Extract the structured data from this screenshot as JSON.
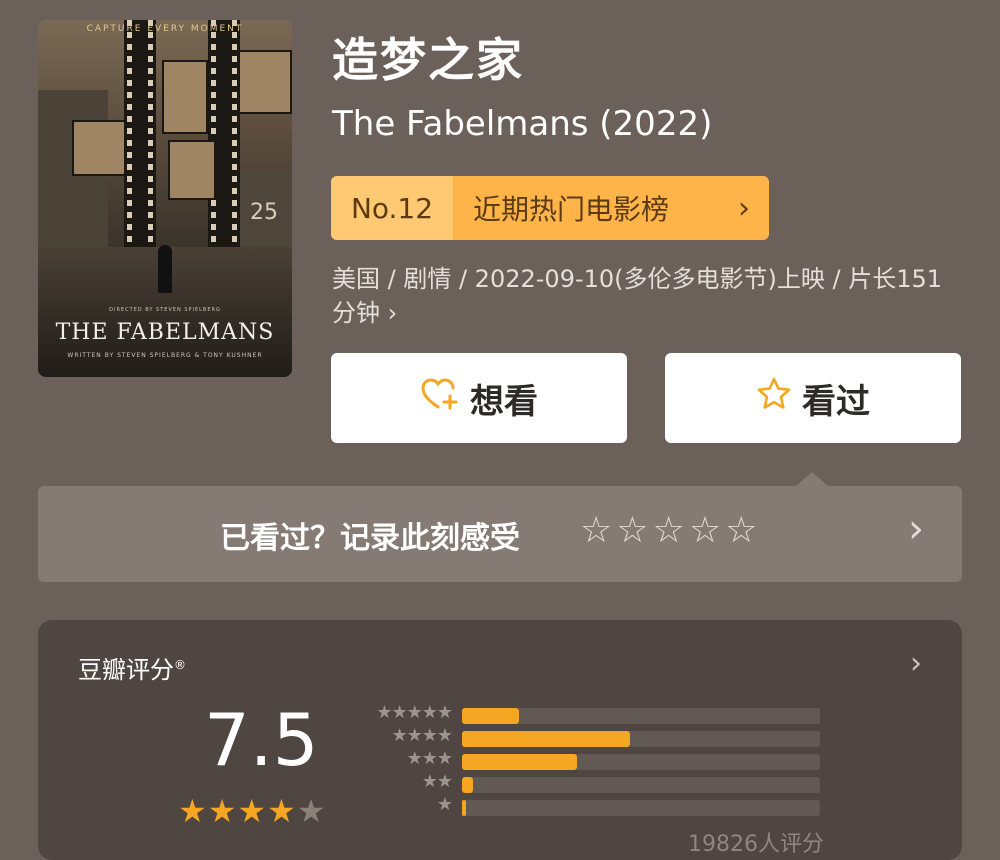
{
  "poster": {
    "tagline": "CAPTURE EVERY MOMENT",
    "title": "THE FABELMANS",
    "director_credit": "DIRECTED BY STEVEN SPIELBERG",
    "writer_credit": "WRITTEN BY STEVEN SPIELBERG & TONY KUSHNER",
    "stage_number": "25"
  },
  "title_cn": "造梦之家",
  "title_en": "The Fabelmans (2022)",
  "rank": {
    "number": "No.12",
    "label": "近期热门电影榜",
    "chevron": "›"
  },
  "meta": "美国 / 剧情 / 2022-09-10(多伦多电影节)上映 / 片长151分钟 ›",
  "buttons": {
    "want": {
      "icon": "heart-plus-icon",
      "label": "想看"
    },
    "seen": {
      "icon": "star-outline-icon",
      "label": "看过"
    }
  },
  "record": {
    "prompt": "已看过？记录此刻感受",
    "stars": "☆☆☆☆☆",
    "arrow": "›"
  },
  "rating": {
    "header": "豆瓣评分",
    "mark": "®",
    "arrow": "›",
    "score": "7.5",
    "stars_on": "★★★★",
    "stars_off": "★",
    "distribution": [
      {
        "stars": "★★★★★",
        "fraction": 0.16
      },
      {
        "stars": "★★★★",
        "fraction": 0.47
      },
      {
        "stars": "★★★",
        "fraction": 0.32
      },
      {
        "stars": "★★",
        "fraction": 0.03
      },
      {
        "stars": "★",
        "fraction": 0.01
      }
    ],
    "count": "19826人评分"
  },
  "colors": {
    "accent": "#f5a623",
    "background": "#6b605a"
  }
}
